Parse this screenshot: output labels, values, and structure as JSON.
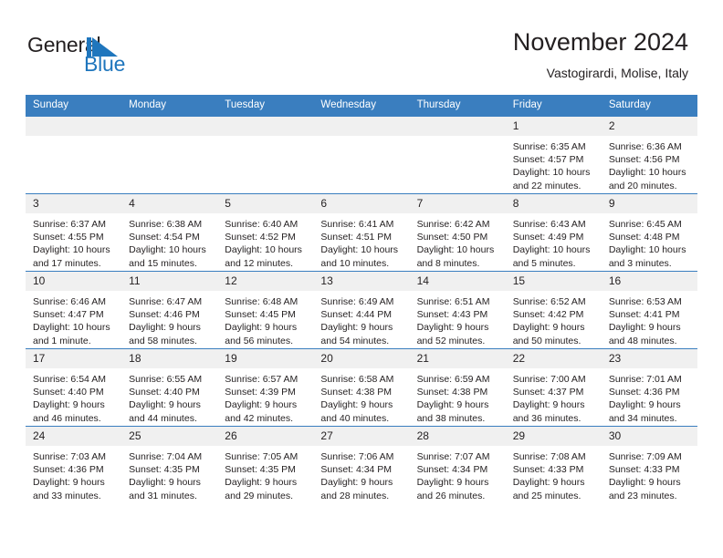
{
  "branding": {
    "name_part1": "General",
    "name_part2": "Blue",
    "mark_icon": "triangle-flag-icon",
    "accent_color": "#1f76bd"
  },
  "header": {
    "title": "November 2024",
    "subtitle": "Vastogirardi, Molise, Italy"
  },
  "theme": {
    "header_bg": "#3a7ebf",
    "daynum_bg": "#f0f0f0",
    "text": "#231f20"
  },
  "weekday_headers": [
    "Sunday",
    "Monday",
    "Tuesday",
    "Wednesday",
    "Thursday",
    "Friday",
    "Saturday"
  ],
  "weeks": [
    [
      {
        "day": "",
        "blank": true
      },
      {
        "day": "",
        "blank": true
      },
      {
        "day": "",
        "blank": true
      },
      {
        "day": "",
        "blank": true
      },
      {
        "day": "",
        "blank": true
      },
      {
        "day": "1",
        "sunrise": "Sunrise: 6:35 AM",
        "sunset": "Sunset: 4:57 PM",
        "daylight": "Daylight: 10 hours and 22 minutes."
      },
      {
        "day": "2",
        "sunrise": "Sunrise: 6:36 AM",
        "sunset": "Sunset: 4:56 PM",
        "daylight": "Daylight: 10 hours and 20 minutes."
      }
    ],
    [
      {
        "day": "3",
        "sunrise": "Sunrise: 6:37 AM",
        "sunset": "Sunset: 4:55 PM",
        "daylight": "Daylight: 10 hours and 17 minutes."
      },
      {
        "day": "4",
        "sunrise": "Sunrise: 6:38 AM",
        "sunset": "Sunset: 4:54 PM",
        "daylight": "Daylight: 10 hours and 15 minutes."
      },
      {
        "day": "5",
        "sunrise": "Sunrise: 6:40 AM",
        "sunset": "Sunset: 4:52 PM",
        "daylight": "Daylight: 10 hours and 12 minutes."
      },
      {
        "day": "6",
        "sunrise": "Sunrise: 6:41 AM",
        "sunset": "Sunset: 4:51 PM",
        "daylight": "Daylight: 10 hours and 10 minutes."
      },
      {
        "day": "7",
        "sunrise": "Sunrise: 6:42 AM",
        "sunset": "Sunset: 4:50 PM",
        "daylight": "Daylight: 10 hours and 8 minutes."
      },
      {
        "day": "8",
        "sunrise": "Sunrise: 6:43 AM",
        "sunset": "Sunset: 4:49 PM",
        "daylight": "Daylight: 10 hours and 5 minutes."
      },
      {
        "day": "9",
        "sunrise": "Sunrise: 6:45 AM",
        "sunset": "Sunset: 4:48 PM",
        "daylight": "Daylight: 10 hours and 3 minutes."
      }
    ],
    [
      {
        "day": "10",
        "sunrise": "Sunrise: 6:46 AM",
        "sunset": "Sunset: 4:47 PM",
        "daylight": "Daylight: 10 hours and 1 minute."
      },
      {
        "day": "11",
        "sunrise": "Sunrise: 6:47 AM",
        "sunset": "Sunset: 4:46 PM",
        "daylight": "Daylight: 9 hours and 58 minutes."
      },
      {
        "day": "12",
        "sunrise": "Sunrise: 6:48 AM",
        "sunset": "Sunset: 4:45 PM",
        "daylight": "Daylight: 9 hours and 56 minutes."
      },
      {
        "day": "13",
        "sunrise": "Sunrise: 6:49 AM",
        "sunset": "Sunset: 4:44 PM",
        "daylight": "Daylight: 9 hours and 54 minutes."
      },
      {
        "day": "14",
        "sunrise": "Sunrise: 6:51 AM",
        "sunset": "Sunset: 4:43 PM",
        "daylight": "Daylight: 9 hours and 52 minutes."
      },
      {
        "day": "15",
        "sunrise": "Sunrise: 6:52 AM",
        "sunset": "Sunset: 4:42 PM",
        "daylight": "Daylight: 9 hours and 50 minutes."
      },
      {
        "day": "16",
        "sunrise": "Sunrise: 6:53 AM",
        "sunset": "Sunset: 4:41 PM",
        "daylight": "Daylight: 9 hours and 48 minutes."
      }
    ],
    [
      {
        "day": "17",
        "sunrise": "Sunrise: 6:54 AM",
        "sunset": "Sunset: 4:40 PM",
        "daylight": "Daylight: 9 hours and 46 minutes."
      },
      {
        "day": "18",
        "sunrise": "Sunrise: 6:55 AM",
        "sunset": "Sunset: 4:40 PM",
        "daylight": "Daylight: 9 hours and 44 minutes."
      },
      {
        "day": "19",
        "sunrise": "Sunrise: 6:57 AM",
        "sunset": "Sunset: 4:39 PM",
        "daylight": "Daylight: 9 hours and 42 minutes."
      },
      {
        "day": "20",
        "sunrise": "Sunrise: 6:58 AM",
        "sunset": "Sunset: 4:38 PM",
        "daylight": "Daylight: 9 hours and 40 minutes."
      },
      {
        "day": "21",
        "sunrise": "Sunrise: 6:59 AM",
        "sunset": "Sunset: 4:38 PM",
        "daylight": "Daylight: 9 hours and 38 minutes."
      },
      {
        "day": "22",
        "sunrise": "Sunrise: 7:00 AM",
        "sunset": "Sunset: 4:37 PM",
        "daylight": "Daylight: 9 hours and 36 minutes."
      },
      {
        "day": "23",
        "sunrise": "Sunrise: 7:01 AM",
        "sunset": "Sunset: 4:36 PM",
        "daylight": "Daylight: 9 hours and 34 minutes."
      }
    ],
    [
      {
        "day": "24",
        "sunrise": "Sunrise: 7:03 AM",
        "sunset": "Sunset: 4:36 PM",
        "daylight": "Daylight: 9 hours and 33 minutes."
      },
      {
        "day": "25",
        "sunrise": "Sunrise: 7:04 AM",
        "sunset": "Sunset: 4:35 PM",
        "daylight": "Daylight: 9 hours and 31 minutes."
      },
      {
        "day": "26",
        "sunrise": "Sunrise: 7:05 AM",
        "sunset": "Sunset: 4:35 PM",
        "daylight": "Daylight: 9 hours and 29 minutes."
      },
      {
        "day": "27",
        "sunrise": "Sunrise: 7:06 AM",
        "sunset": "Sunset: 4:34 PM",
        "daylight": "Daylight: 9 hours and 28 minutes."
      },
      {
        "day": "28",
        "sunrise": "Sunrise: 7:07 AM",
        "sunset": "Sunset: 4:34 PM",
        "daylight": "Daylight: 9 hours and 26 minutes."
      },
      {
        "day": "29",
        "sunrise": "Sunrise: 7:08 AM",
        "sunset": "Sunset: 4:33 PM",
        "daylight": "Daylight: 9 hours and 25 minutes."
      },
      {
        "day": "30",
        "sunrise": "Sunrise: 7:09 AM",
        "sunset": "Sunset: 4:33 PM",
        "daylight": "Daylight: 9 hours and 23 minutes."
      }
    ]
  ]
}
